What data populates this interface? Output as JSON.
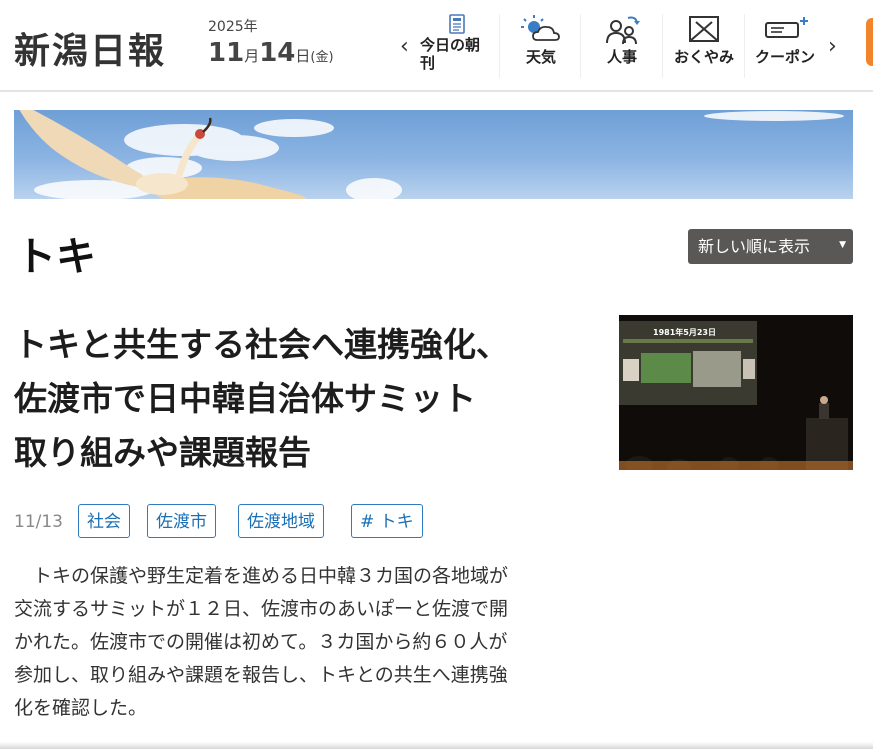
{
  "header": {
    "logo": "新潟日報",
    "date": {
      "year": "2025年",
      "month": "11",
      "month_unit": "月",
      "day": "14",
      "day_unit": "日",
      "weekday": "(金)"
    },
    "nav": [
      {
        "label_line1": "今日の朝",
        "label_line2": "刊",
        "icon": "newspaper-icon"
      },
      {
        "label": "天気",
        "icon": "weather-icon"
      },
      {
        "label": "人事",
        "icon": "people-icon"
      },
      {
        "label": "おくやみ",
        "icon": "condolence-icon"
      },
      {
        "label": "クーポン",
        "icon": "coupon-icon"
      }
    ]
  },
  "topic": {
    "title": "トキ"
  },
  "sort": {
    "label": "新しい順に表示"
  },
  "article": {
    "title_lines": [
      "トキと共生する社会へ連携強化、",
      "佐渡市で日中韓自治体サミット",
      "取り組みや課題報告"
    ],
    "date": "11/13",
    "tags": [
      "社会",
      "佐渡市",
      "佐渡地域",
      "# トキ"
    ],
    "excerpt_lines": [
      "　トキの保護や野生定着を進める日中韓３カ国の各地域が",
      "交流するサミットが１２日、佐渡市のあいぽーと佐渡で開",
      "かれた。佐渡市での開催は初めて。３カ国から約６０人が",
      "参加し、取り組みや課題を報告し、トキとの共生へ連携強",
      "化を確認した。"
    ],
    "thumbnail": {
      "slide_title": "1981年5月23日"
    }
  },
  "colors": {
    "accent_orange": "#f2842b",
    "tag_blue": "#1b6fb5",
    "sort_bg": "#5a5856"
  }
}
